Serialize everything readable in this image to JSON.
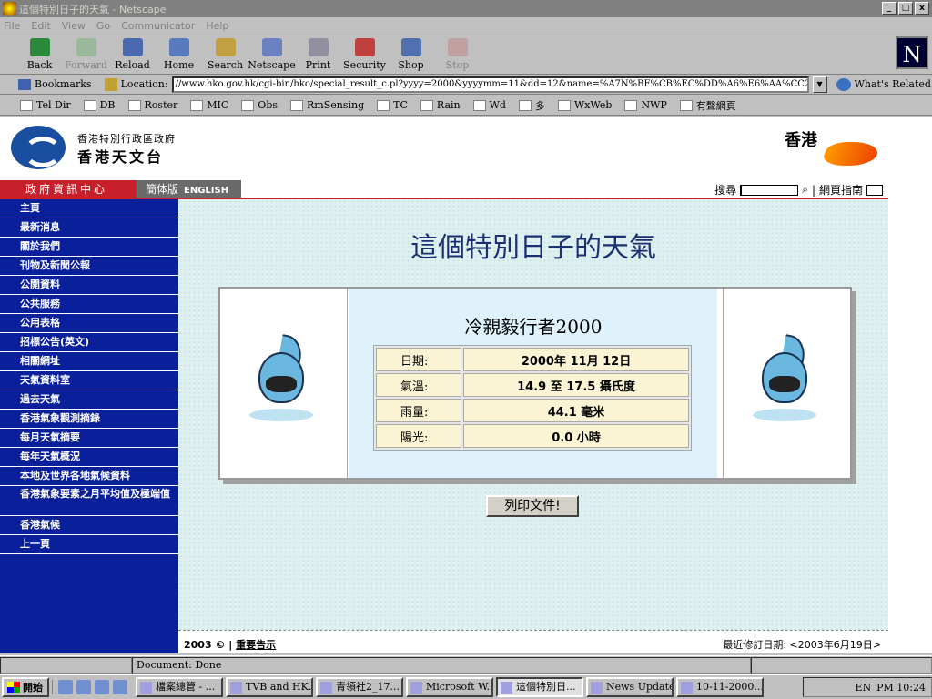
{
  "window": {
    "title": "這個特別日子的天氣 - Netscape",
    "controls": {
      "minimize": "_",
      "maximize": "□",
      "close": "x"
    }
  },
  "menu": [
    "File",
    "Edit",
    "View",
    "Go",
    "Communicator",
    "Help"
  ],
  "toolbar": {
    "back": "Back",
    "forward": "Forward",
    "reload": "Reload",
    "home": "Home",
    "search": "Search",
    "netscape": "Netscape",
    "print": "Print",
    "security": "Security",
    "shop": "Shop",
    "stop": "Stop",
    "logo": "N"
  },
  "location": {
    "bookmarks": "Bookmarks",
    "label": "Location:",
    "url": "//www.hko.gov.hk/cgi-bin/hko/special_result_c.pl?yyyy=2000&yyyymm=11&dd=12&name=%A7N%BF%CB%EC%DD%A6%E6%AA%CC2000",
    "whats_related": "What's Related"
  },
  "personal_toolbar": [
    "Tel Dir",
    "DB",
    "Roster",
    "MIC",
    "Obs",
    "RmSensing",
    "TC",
    "Rain",
    "Wd",
    "多",
    "WxWeb",
    "NWP",
    "有聲網頁"
  ],
  "header": {
    "org_line1": "香港特別行政區政府",
    "org_line2": "香港天文台",
    "brand": "香港"
  },
  "navstrip": {
    "gov_info": "政府資訊中心",
    "simplified": "簡体版",
    "english": "ENGLISH",
    "search_label": "搜尋",
    "site_guide": "網頁指南"
  },
  "sidebar": {
    "items": [
      {
        "label": "主頁"
      },
      {
        "label": "最新消息"
      },
      {
        "label": "關於我們"
      },
      {
        "label": "刊物及新聞公報"
      },
      {
        "label": "公開資料"
      },
      {
        "label": "公共服務"
      },
      {
        "label": "公用表格"
      },
      {
        "label": "招標公告(英文)"
      },
      {
        "label": "相關網址"
      },
      {
        "label": "天氣資料室"
      },
      {
        "label": "過去天氣"
      },
      {
        "label": "香港氣象觀測摘錄"
      },
      {
        "label": "每月天氣摘要"
      },
      {
        "label": "每年天氣概況"
      },
      {
        "label": "本地及世界各地氣候資料"
      },
      {
        "label": "香港氣象要素之月平均值及極端值"
      },
      {
        "label": "香港氣候"
      },
      {
        "label": "上一頁"
      }
    ]
  },
  "main": {
    "title": "這個特別日子的天氣",
    "card_title": "冷親毅行者2000",
    "rows": [
      {
        "label": "日期:",
        "value": "2000年 11月 12日"
      },
      {
        "label": "氣溫:",
        "value": "14.9 至 17.5 攝氏度"
      },
      {
        "label": "雨量:",
        "value": "44.1 毫米"
      },
      {
        "label": "陽光:",
        "value": "0.0 小時"
      }
    ],
    "print_button": "列印文件!"
  },
  "footer": {
    "copyright": "2003 ©",
    "notice": "重要告示",
    "revised": "最近修訂日期: <2003年6月19日>"
  },
  "status": {
    "text": "Document: Done"
  },
  "taskbar": {
    "start": "開始",
    "tasks": [
      {
        "label": "檔案總管 - ...",
        "active": false
      },
      {
        "label": "TVB and HK...",
        "active": false
      },
      {
        "label": "青領社2_17...",
        "active": false
      },
      {
        "label": "Microsoft W...",
        "active": false
      },
      {
        "label": "這個特別日...",
        "active": true
      },
      {
        "label": "News Update...",
        "active": false
      },
      {
        "label": "10-11-2000...",
        "active": false
      }
    ],
    "lang": "EN",
    "clock": "PM 10:24"
  },
  "colors": {
    "sidebar_bg": "#0a1f9a",
    "accent_red": "#c8202a",
    "title_blue": "#1a3070",
    "page_bg": "#dff0f0"
  }
}
